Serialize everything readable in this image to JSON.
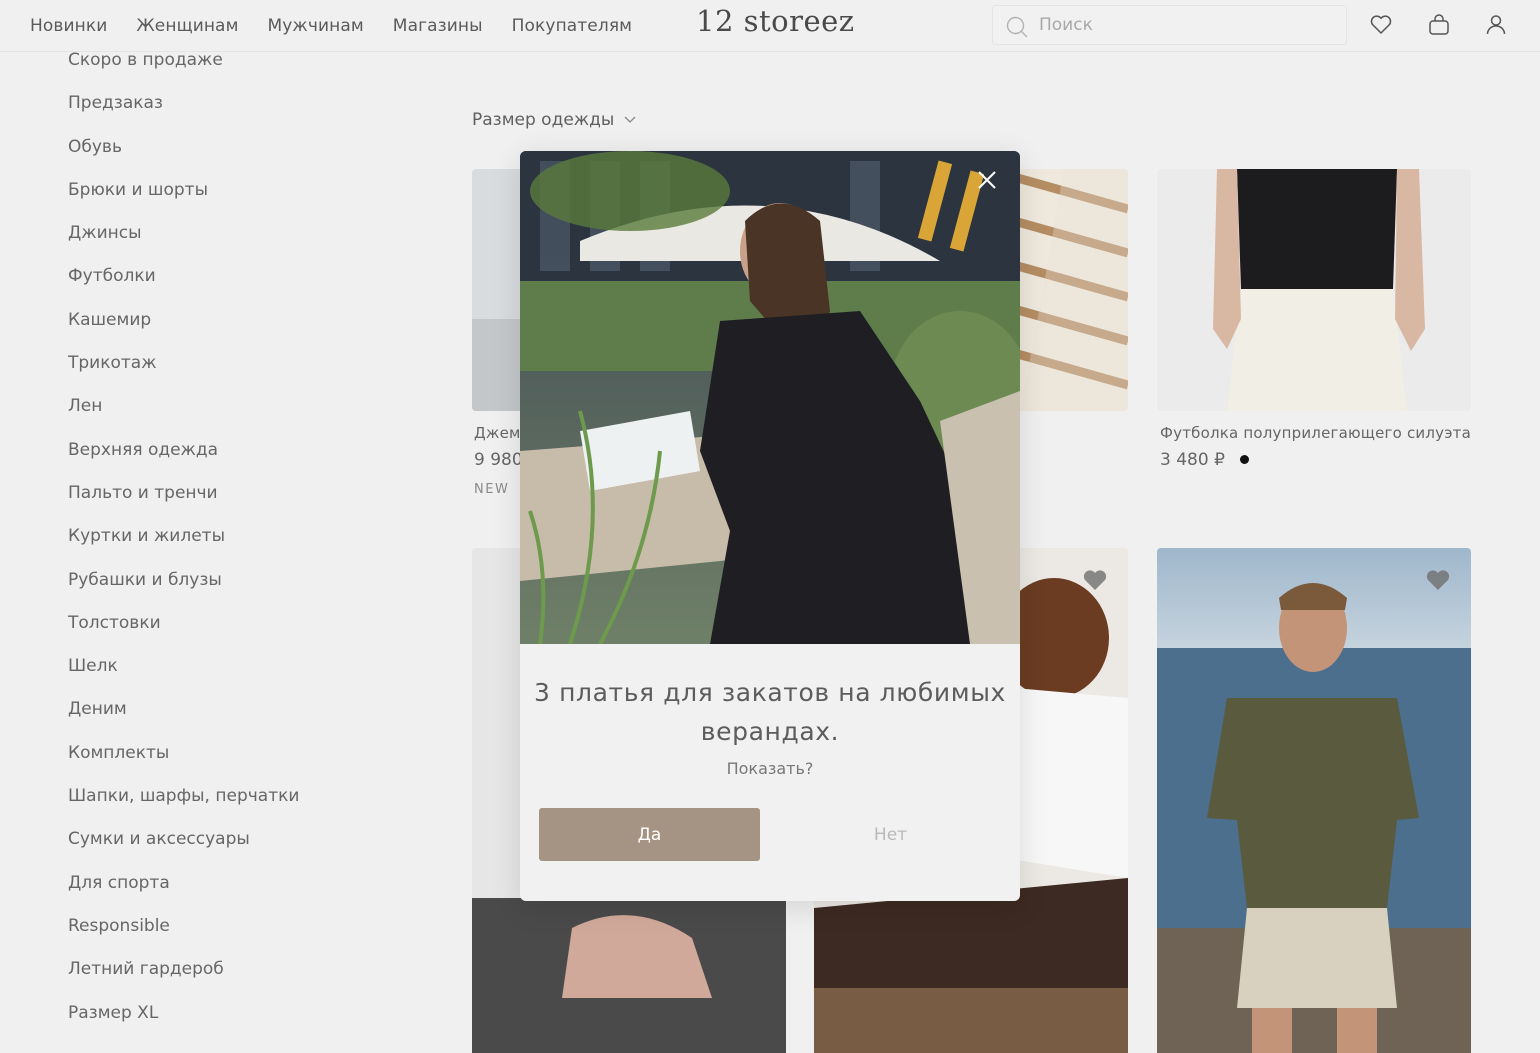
{
  "header": {
    "nav": [
      "Новинки",
      "Женщинам",
      "Мужчинам",
      "Магазины",
      "Покупателям"
    ],
    "logo": "12 storeez",
    "search_placeholder": "Поиск",
    "icons": [
      "search-icon",
      "heart-icon",
      "bag-icon",
      "user-icon"
    ]
  },
  "sidebar": {
    "items": [
      "Скоро в продаже",
      "Предзаказ",
      "Обувь",
      "Брюки и шорты",
      "Джинсы",
      "Футболки",
      "Кашемир",
      "Трикотаж",
      "Лен",
      "Верхняя одежда",
      "Пальто и тренчи",
      "Куртки и жилеты",
      "Рубашки и блузы",
      "Толстовки",
      "Шелк",
      "Деним",
      "Комплекты",
      "Шапки, шарфы, перчатки",
      "Сумки и аксессуары",
      "Для спорта",
      "Responsible",
      "Летний гардероб",
      "Размер XL"
    ]
  },
  "filters": {
    "size_label": "Размер одежды"
  },
  "products": [
    {
      "name": "Джем",
      "price": "9 980",
      "badge": "NEW"
    },
    {
      "name": "Футболка полуприлегающего силуэта",
      "price": "3 480 ₽"
    }
  ],
  "modal": {
    "title": "3 платья для закатов на любимых верандах.",
    "subtitle": "Показать?",
    "yes_label": "Да",
    "no_label": "Нет"
  },
  "colors": {
    "accent": "#a59483",
    "background": "#f0f0f0"
  }
}
